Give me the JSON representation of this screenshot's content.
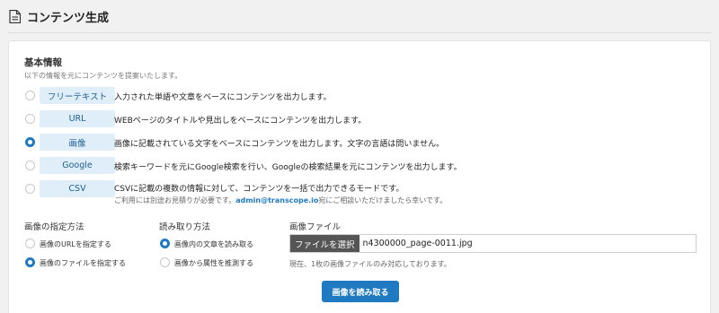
{
  "header": {
    "title": "コンテンツ生成",
    "icon": "document-icon"
  },
  "basic": {
    "title": "基本情報",
    "subtitle": "以下の情報を元にコンテンツを提案いたします。"
  },
  "types": [
    {
      "label": "フリーテキスト",
      "desc": "入力された単語や文章をベースにコンテンツを出力します。",
      "selected": false
    },
    {
      "label": "URL",
      "desc": "WEBページのタイトルや見出しをベースにコンテンツを出力します。",
      "selected": false
    },
    {
      "label": "画像",
      "desc": "画像に記載されている文字をベースにコンテンツを出力します。文字の言語は問いません。",
      "selected": true
    },
    {
      "label": "Google",
      "desc": "検索キーワードを元にGoogle検索を行い、Googleの検索結果を元にコンテンツを出力します。",
      "selected": false
    },
    {
      "label": "CSV",
      "desc": "CSVに記載の複数の情報に対して、コンテンツを一括で出力できるモードです。",
      "selected": false
    }
  ],
  "csv_note": {
    "prefix": "ご利用には別途お見積りが必要です。",
    "email": "admin@transcope.io",
    "suffix": "宛にご相談いただけましたら幸いです。"
  },
  "image_method": {
    "title": "画像の指定方法",
    "options": [
      {
        "label": "画像のURLを指定する",
        "selected": false
      },
      {
        "label": "画像のファイルを指定する",
        "selected": true
      }
    ]
  },
  "read_method": {
    "title": "読み取り方法",
    "options": [
      {
        "label": "画像内の文章を読み取る",
        "selected": true
      },
      {
        "label": "画像から属性を推測する",
        "selected": false
      }
    ]
  },
  "image_file": {
    "title": "画像ファイル",
    "button_label": "ファイルを選択",
    "file_name": "n4300000_page-0011.jpg",
    "note": "現在、1枚の画像ファイルのみ対応しております。"
  },
  "submit_label": "画像を読み取る",
  "colors": {
    "accent": "#1f7ac2",
    "badge_bg": "#dfeef9",
    "badge_text": "#1d5f93"
  }
}
